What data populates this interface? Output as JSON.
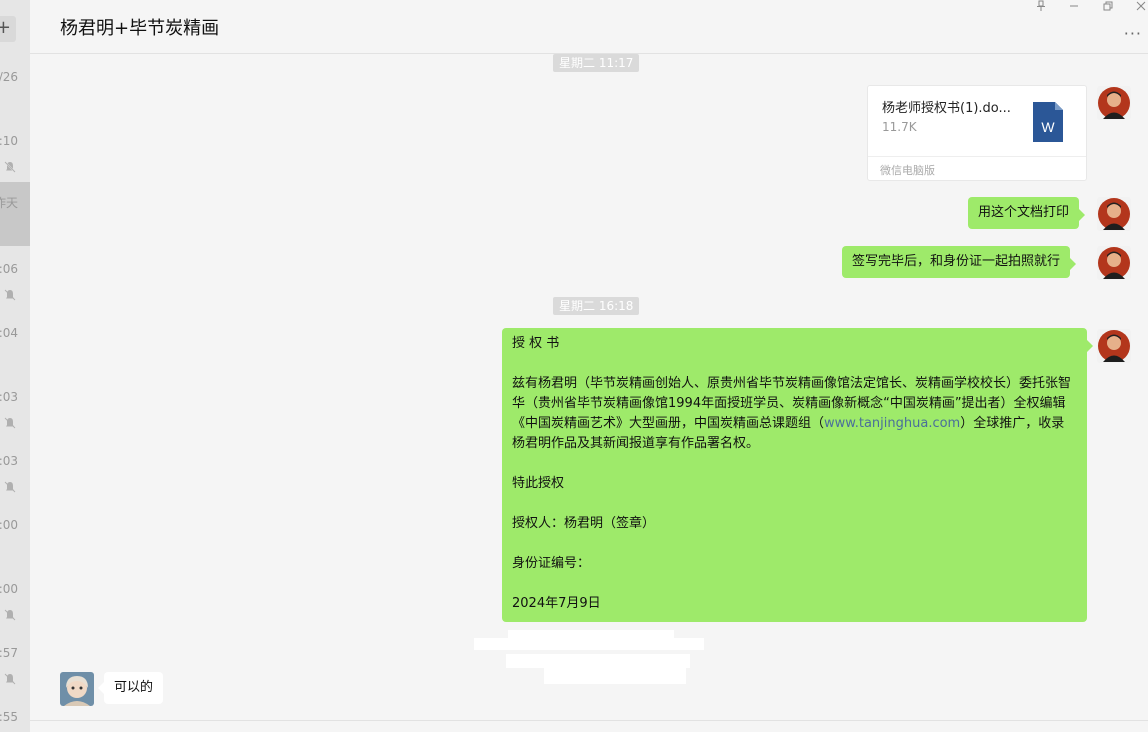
{
  "sidebar": {
    "add_label": "+",
    "items": [
      {
        "time": "/26",
        "muted": false,
        "selected": false
      },
      {
        "time": ":10",
        "muted": true,
        "selected": false
      },
      {
        "time": "昨天",
        "muted": false,
        "selected": true
      },
      {
        "time": ":06",
        "muted": true,
        "selected": false
      },
      {
        "time": ":04",
        "muted": false,
        "selected": false
      },
      {
        "time": ":03",
        "muted": true,
        "selected": false
      },
      {
        "time": ":03",
        "muted": true,
        "selected": false
      },
      {
        "time": ":00",
        "muted": false,
        "selected": false
      },
      {
        "time": ":00",
        "muted": true,
        "selected": false
      },
      {
        "time": ":57",
        "muted": true,
        "selected": false
      },
      {
        "time": ":55",
        "muted": false,
        "selected": false
      }
    ]
  },
  "header": {
    "title": "杨君明+毕节炭精画",
    "more_label": "···"
  },
  "messages": {
    "stamp1": "星期二 11:17",
    "file": {
      "name": "杨老师授权书(1).do...",
      "size": "11.7K",
      "source": "微信电脑版",
      "icon_letter": "W"
    },
    "msg1": "用这个文档打印",
    "msg2": "签写完毕后，和身份证一起拍照就行",
    "stamp2": "星期二 16:18",
    "doc": {
      "title": "授 权 书",
      "body_before_link": "兹有杨君明（毕节炭精画创始人、原贵州省毕节炭精画像馆法定馆长、炭精画学校校长）委托张智华（贵州省毕节炭精画像馆1994年面授班学员、炭精画像新概念“中国炭精画”提出者）全权编辑《中国炭精画艺术》大型画册，中国炭精画总课题组（",
      "link": "www.tanjinghua.com",
      "body_after_link": "）全球推广，收录杨君明作品及其新闻报道享有作品署名权。",
      "authorize": "特此授权",
      "grantor": "授权人：杨君明（签章）",
      "id_label": "身份证编号：",
      "date": "2024年7月9日"
    },
    "incoming": "可以的"
  },
  "colors": {
    "bubble_green": "#9eea6a",
    "background": "#f5f5f5",
    "word_blue": "#2b5797"
  }
}
